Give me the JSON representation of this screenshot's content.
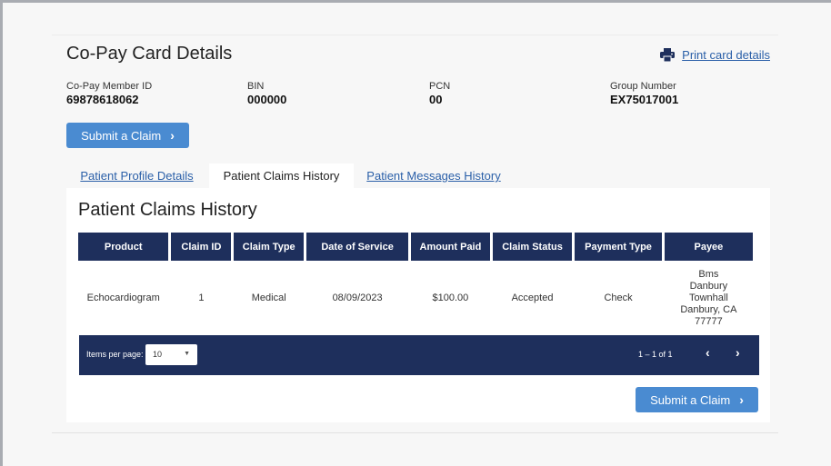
{
  "header": {
    "title": "Co-Pay Card Details",
    "print_link": "Print card details",
    "print_icon": "printer-icon"
  },
  "card_info": [
    {
      "label": "Co-Pay Member ID",
      "value": "69878618062"
    },
    {
      "label": "BIN",
      "value": "000000"
    },
    {
      "label": "PCN",
      "value": "00"
    },
    {
      "label": "Group Number",
      "value": "EX75017001"
    }
  ],
  "buttons": {
    "submit_claim_top": "Submit a Claim",
    "submit_claim_bottom": "Submit a Claim",
    "chevron": "›"
  },
  "tabs": [
    {
      "label": "Patient Profile Details",
      "active": false
    },
    {
      "label": "Patient Claims History",
      "active": true
    },
    {
      "label": "Patient Messages History",
      "active": false
    }
  ],
  "claims": {
    "title": "Patient Claims History",
    "columns": [
      "Product",
      "Claim ID",
      "Claim Type",
      "Date of Service",
      "Amount Paid",
      "Claim Status",
      "Payment Type",
      "Payee"
    ],
    "rows": [
      {
        "product": "Echocardiogram",
        "claim_id": "1",
        "claim_type": "Medical",
        "date_of_service": "08/09/2023",
        "amount_paid": "$100.00",
        "claim_status": "Accepted",
        "payment_type": "Check",
        "payee_lines": [
          "Bms",
          "Danbury",
          "Townhall",
          "Danbury, CA",
          "77777"
        ]
      }
    ]
  },
  "pager": {
    "items_per_page_label": "Items per page:",
    "items_per_page_value": "10",
    "range": "1 – 1 of 1",
    "prev": "‹",
    "next": "›"
  },
  "colors": {
    "header_navy": "#1e2f5c",
    "button_blue": "#4a8bd1",
    "link_blue": "#2a5fa8"
  }
}
